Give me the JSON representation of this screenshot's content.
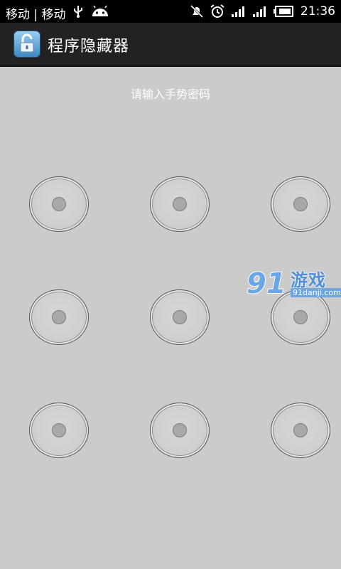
{
  "status_bar": {
    "carrier": "移动 | 移动",
    "clock": "21:36",
    "icons": [
      "usb-icon",
      "android-icon",
      "mute-icon",
      "alarm-icon",
      "signal-icon",
      "signal-icon",
      "battery-icon"
    ]
  },
  "action_bar": {
    "title": "程序隐藏器",
    "icon": "lock-icon"
  },
  "main": {
    "prompt": "请输入手势密码",
    "pattern_nodes": 9
  },
  "watermark": {
    "logo": "91",
    "text": "游戏",
    "url": "91danji.com"
  },
  "colors": {
    "background": "#cbcbcb",
    "status_bar": "#000000",
    "action_bar": "#222222",
    "watermark_blue": "#4f8fd9"
  }
}
